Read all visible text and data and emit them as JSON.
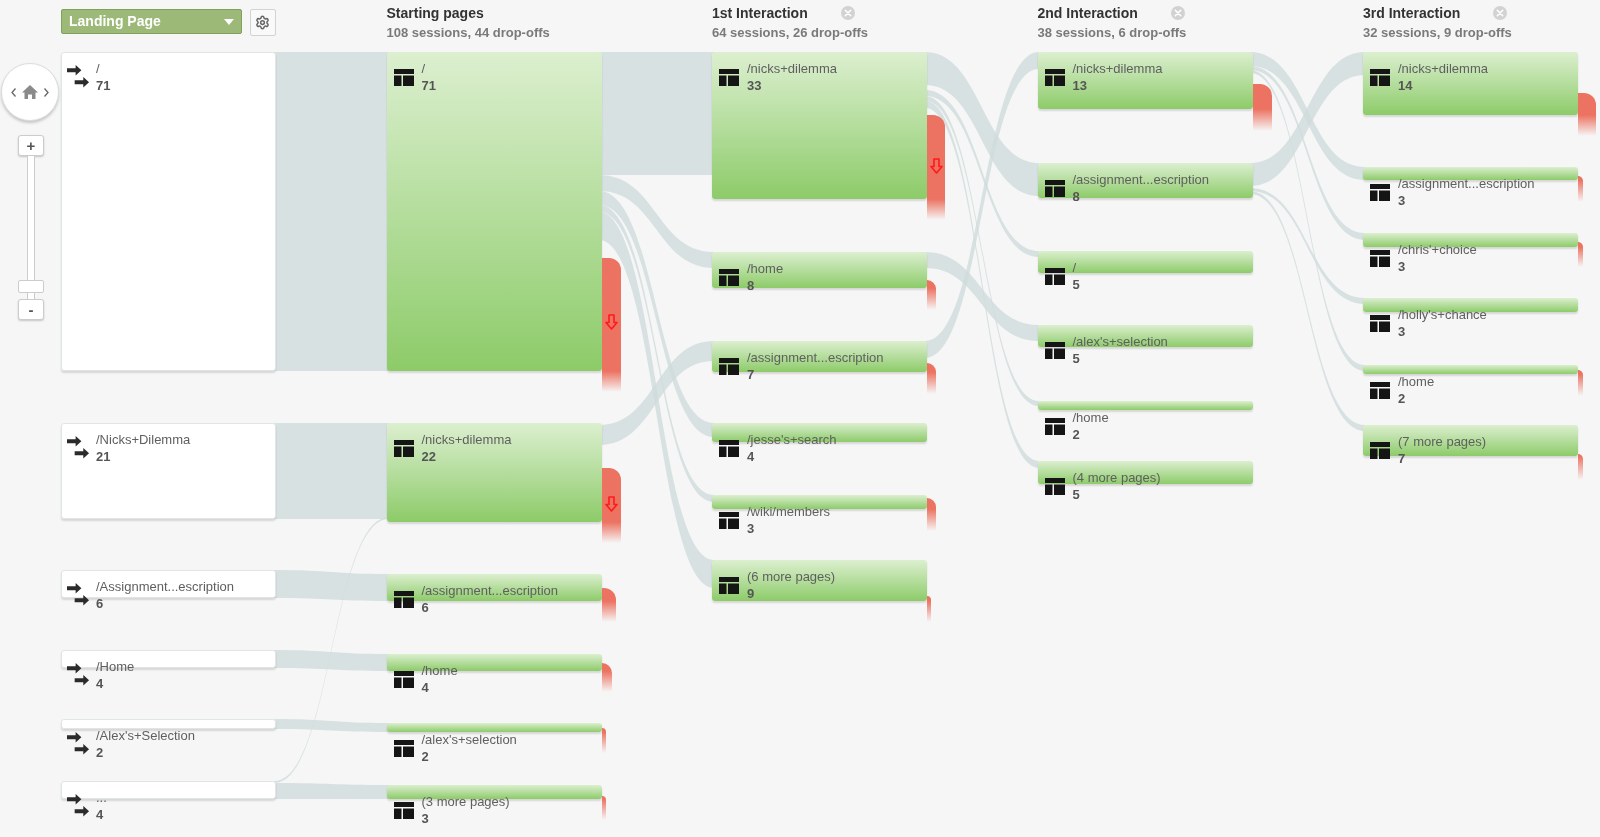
{
  "map_controls": {
    "zoom_in": "+",
    "zoom_out": "-",
    "zoom": {
      "level": 0.05
    }
  },
  "columns": [
    {
      "kind": "landing",
      "dimension": "Landing Page",
      "nodes": [
        {
          "label": "/",
          "count": "71"
        },
        {
          "label": "/Nicks+Dilemma",
          "count": "21"
        },
        {
          "label": "/Assignment...escription",
          "count": "6"
        },
        {
          "label": "/Home",
          "count": "4"
        },
        {
          "label": "/Alex's+Selection",
          "count": "2"
        },
        {
          "label": "...",
          "count": "4"
        }
      ]
    },
    {
      "kind": "pages",
      "title": "Starting pages",
      "summary": "108 sessions, 44 drop-offs",
      "closable": false,
      "nodes": [
        {
          "label": "/",
          "count": "71",
          "drop_off": true
        },
        {
          "label": "/nicks+dilemma",
          "count": "22",
          "drop_off": true
        },
        {
          "label": "/assignment...escription",
          "count": "6",
          "drop_off": true
        },
        {
          "label": "/home",
          "count": "4",
          "drop_off": true
        },
        {
          "label": "/alex's+selection",
          "count": "2",
          "drop_off": true
        },
        {
          "label": "(3 more pages)",
          "count": "3",
          "drop_off": true
        }
      ]
    },
    {
      "kind": "pages",
      "title": "1st Interaction",
      "summary": "64 sessions, 26 drop-offs",
      "closable": true,
      "nodes": [
        {
          "label": "/nicks+dilemma",
          "count": "33",
          "drop_off": true
        },
        {
          "label": "/home",
          "count": "8",
          "drop_off": true
        },
        {
          "label": "/assignment...escription",
          "count": "7",
          "drop_off": true
        },
        {
          "label": "/jesse's+search",
          "count": "4",
          "drop_off": false
        },
        {
          "label": "/wiki/members",
          "count": "3",
          "drop_off": true
        },
        {
          "label": "(6 more pages)",
          "count": "9",
          "drop_off": true
        }
      ]
    },
    {
      "kind": "pages",
      "title": "2nd Interaction",
      "summary": "38 sessions, 6 drop-offs",
      "closable": true,
      "nodes": [
        {
          "label": "/nicks+dilemma",
          "count": "13",
          "drop_off": true
        },
        {
          "label": "/assignment...escription",
          "count": "8",
          "drop_off": false
        },
        {
          "label": "/",
          "count": "5",
          "drop_off": false
        },
        {
          "label": "/alex's+selection",
          "count": "5",
          "drop_off": false
        },
        {
          "label": "/home",
          "count": "2",
          "drop_off": false
        },
        {
          "label": "(4 more pages)",
          "count": "5",
          "drop_off": false
        }
      ]
    },
    {
      "kind": "pages",
      "title": "3rd Interaction",
      "summary": "32 sessions, 9 drop-offs",
      "closable": true,
      "nodes": [
        {
          "label": "/nicks+dilemma",
          "count": "14",
          "drop_off": true
        },
        {
          "label": "/assignment...escription",
          "count": "3",
          "drop_off": true
        },
        {
          "label": "/chris'+choice",
          "count": "3",
          "drop_off": true
        },
        {
          "label": "/holly's+chance",
          "count": "3",
          "drop_off": false
        },
        {
          "label": "/home",
          "count": "2",
          "drop_off": true
        },
        {
          "label": "(7 more pages)",
          "count": "7",
          "drop_off": true
        }
      ]
    }
  ]
}
